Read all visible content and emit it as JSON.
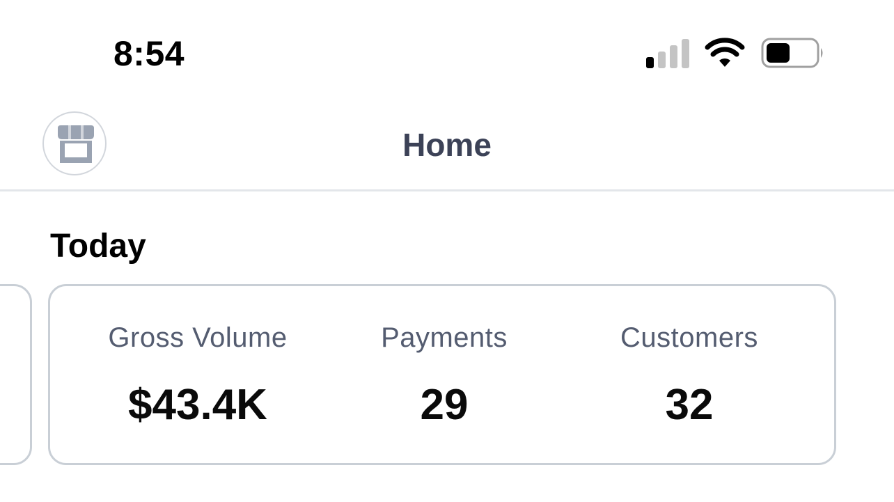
{
  "status_bar": {
    "time": "8:54",
    "signal_bars": 1,
    "signal_bars_total": 4,
    "wifi": "wifi-icon",
    "battery_level": 0.45
  },
  "header": {
    "title": "Home",
    "store_icon": "storefront-icon"
  },
  "section": {
    "title": "Today"
  },
  "metrics": [
    {
      "label": "Gross Volume",
      "value": "$43.4K"
    },
    {
      "label": "Payments",
      "value": "29"
    },
    {
      "label": "Customers",
      "value": "32"
    }
  ],
  "colors": {
    "title_text": "#3c4257",
    "label_text": "#545c70",
    "border": "#c9cfd6",
    "icon_gray": "#9aa3b2"
  }
}
